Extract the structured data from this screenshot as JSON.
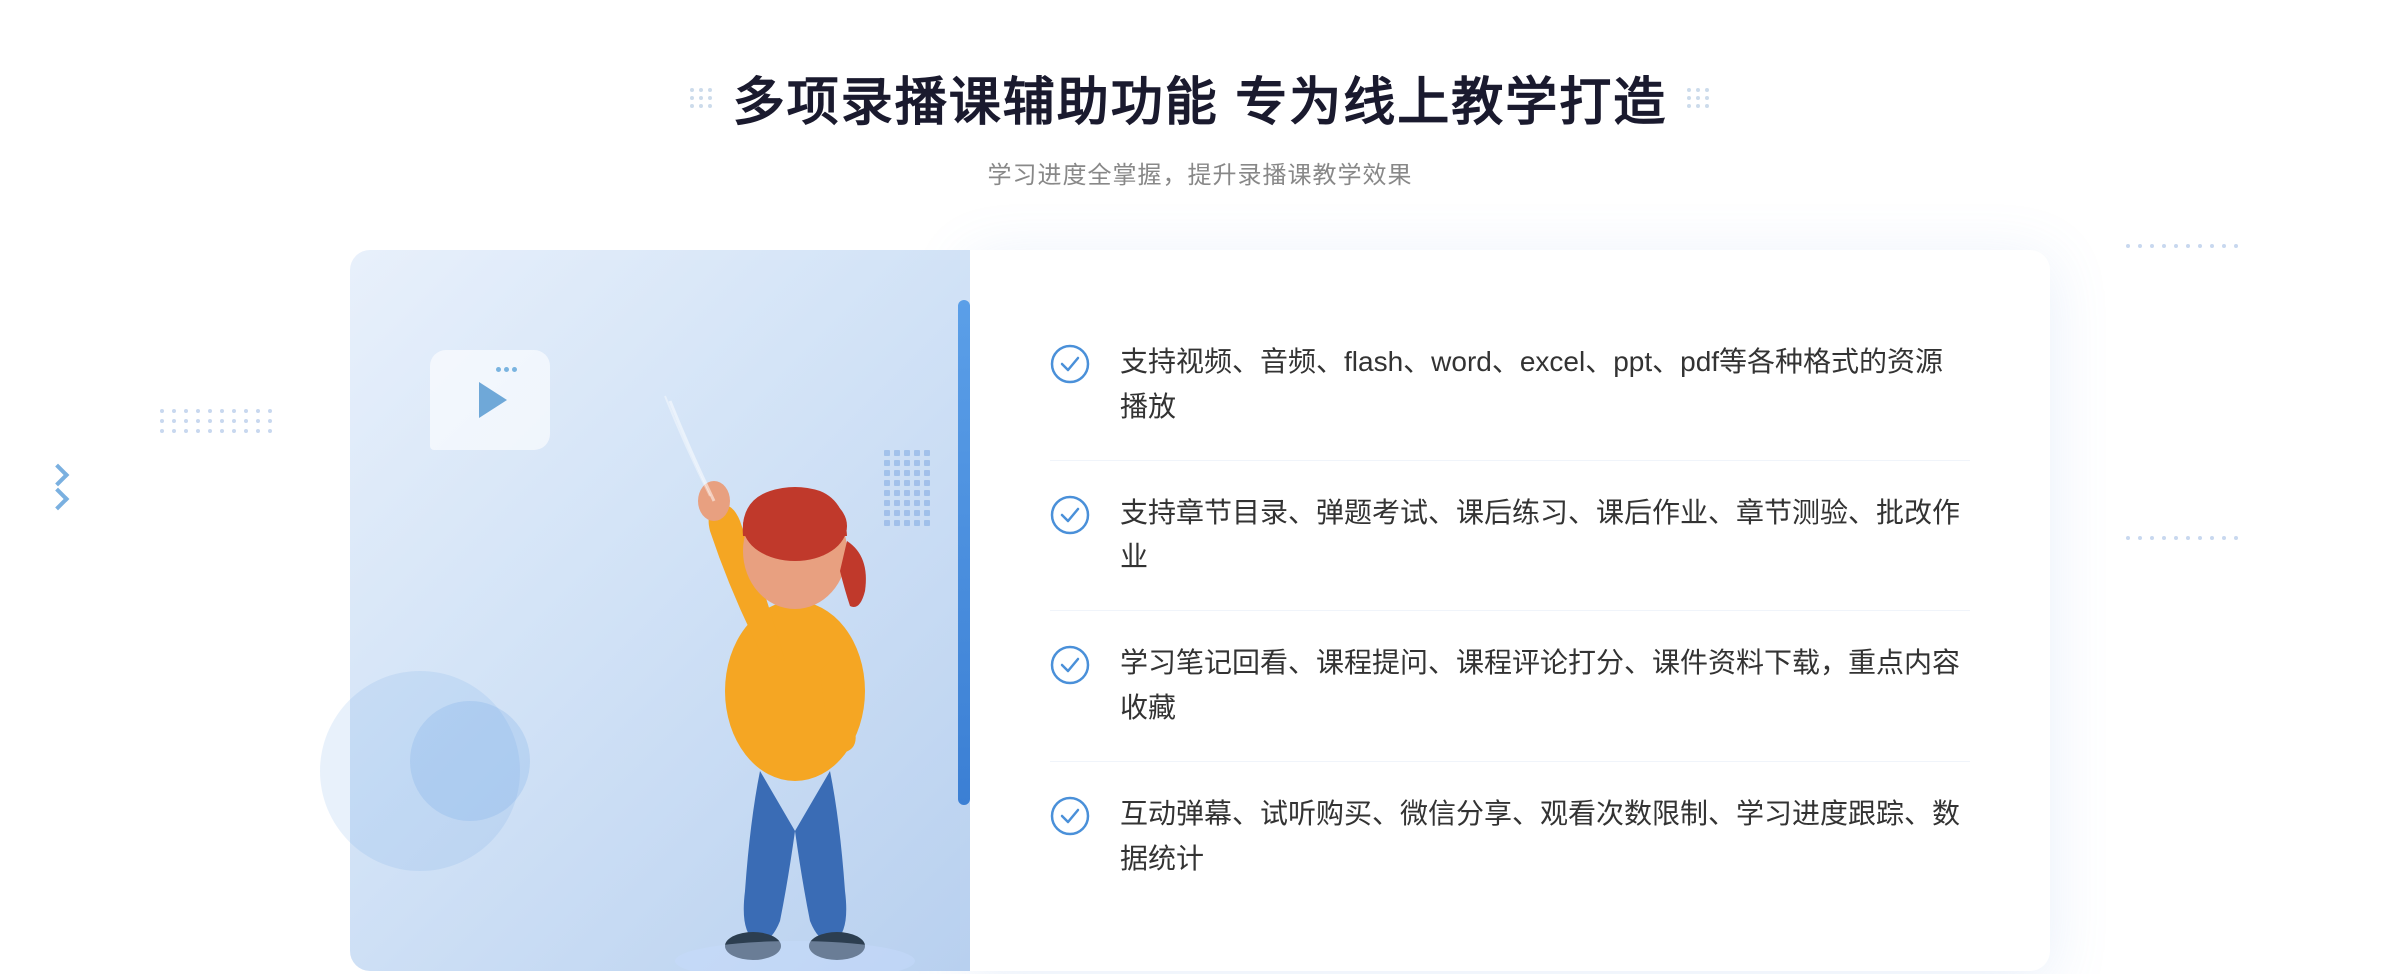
{
  "header": {
    "title": "多项录播课辅助功能 专为线上教学打造",
    "subtitle": "学习进度全掌握，提升录播课教学效果"
  },
  "features": [
    {
      "id": "feature-1",
      "text": "支持视频、音频、flash、word、excel、ppt、pdf等各种格式的资源播放"
    },
    {
      "id": "feature-2",
      "text": "支持章节目录、弹题考试、课后练习、课后作业、章节测验、批改作业"
    },
    {
      "id": "feature-3",
      "text": "学习笔记回看、课程提问、课程评论打分、课件资料下载，重点内容收藏"
    },
    {
      "id": "feature-4",
      "text": "互动弹幕、试听购买、微信分享、观看次数限制、学习进度跟踪、数据统计"
    }
  ],
  "icons": {
    "check": "✓",
    "play": "▶",
    "arrows_left": "»",
    "arrows_right": "«"
  },
  "colors": {
    "primary_blue": "#3b7de8",
    "light_blue": "#6fa8d8",
    "bg_gradient_start": "#e8f0fb",
    "bg_gradient_end": "#b8d0ef",
    "text_dark": "#1a1a2e",
    "text_medium": "#333333",
    "text_light": "#888888"
  }
}
